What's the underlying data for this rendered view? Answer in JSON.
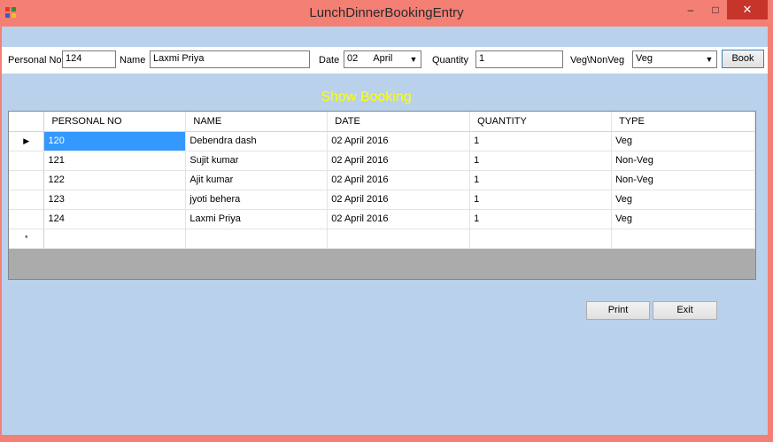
{
  "window": {
    "title": "LunchDinnerBookingEntry",
    "min_glyph": "–",
    "max_glyph": "□",
    "close_glyph": "✕"
  },
  "entry": {
    "personal_no_label": "Personal No",
    "personal_no_value": "124",
    "name_label": "Name",
    "name_value": "Laxmi Priya",
    "date_label": "Date",
    "date_day": "02",
    "date_month": "April",
    "quantity_label": "Quantity",
    "quantity_value": "1",
    "vegnonveg_label": "Veg\\NonVeg",
    "vegnonveg_value": "Veg",
    "book_label": "Book"
  },
  "heading": "Show Booking",
  "grid": {
    "columns": [
      "PERSONAL NO",
      "NAME",
      "DATE",
      "QUANTITY",
      "TYPE"
    ],
    "rows": [
      [
        "120",
        "Debendra dash",
        "02 April 2016",
        "1",
        "Veg"
      ],
      [
        "121",
        "Sujit kumar",
        "02 April 2016",
        "1",
        "Non-Veg"
      ],
      [
        "122",
        "Ajit kumar",
        "02 April 2016",
        "1",
        "Non-Veg"
      ],
      [
        "123",
        "jyoti behera",
        "02 April 2016",
        "1",
        "Veg"
      ],
      [
        "124",
        "Laxmi Priya",
        "02 April 2016",
        "1",
        "Veg"
      ]
    ],
    "current_row_glyph": "▶",
    "new_row_glyph": "*"
  },
  "buttons": {
    "print_label": "Print",
    "exit_label": "Exit"
  },
  "colors": {
    "titlebar": "#f47f74",
    "client": "#b9d1ea",
    "heading": "#ffff00",
    "selection": "#3399ff",
    "close": "#c7342a"
  }
}
